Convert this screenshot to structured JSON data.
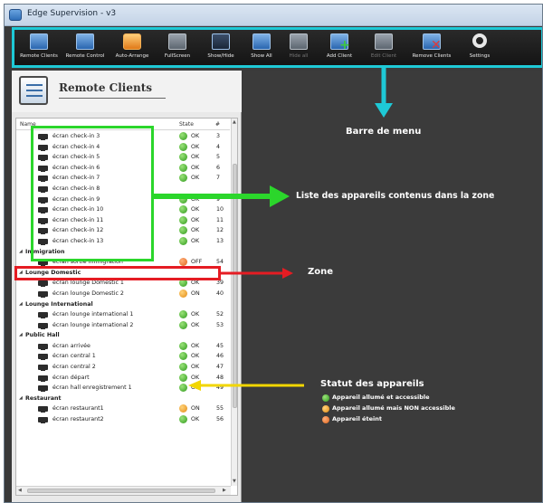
{
  "window": {
    "title": "Edge Supervision - v3"
  },
  "toolbar": {
    "buttons": [
      {
        "label": "Remote Clients",
        "icon": "remote-clients-icon",
        "enabled": true
      },
      {
        "label": "Remote Control",
        "icon": "remote-control-icon",
        "enabled": true
      },
      {
        "label": "Auto-Arrange",
        "icon": "auto-arrange-icon",
        "enabled": true
      },
      {
        "label": "FullScreen",
        "icon": "fullscreen-icon",
        "enabled": true
      },
      {
        "label": "Show/Hide",
        "icon": "show-hide-icon",
        "enabled": true
      },
      {
        "label": "Show All",
        "icon": "show-all-icon",
        "enabled": true
      },
      {
        "label": "Hide all",
        "icon": "hide-all-icon",
        "enabled": false
      },
      {
        "label": "Add Client",
        "icon": "add-client-icon",
        "enabled": true
      },
      {
        "label": "Edit Client",
        "icon": "edit-client-icon",
        "enabled": false
      },
      {
        "label": "Remove Clients",
        "icon": "remove-clients-icon",
        "enabled": true
      },
      {
        "label": "Settings",
        "icon": "settings-icon",
        "enabled": true
      }
    ]
  },
  "panel": {
    "title": "Remote Clients",
    "columns": {
      "name": "Name",
      "state": "State",
      "id": "#"
    },
    "rows": [
      {
        "type": "device",
        "name": "écran check-in 3",
        "status": "ok",
        "state": "OK",
        "id": "3"
      },
      {
        "type": "device",
        "name": "écran check-in 4",
        "status": "ok",
        "state": "OK",
        "id": "4"
      },
      {
        "type": "device",
        "name": "écran check-in 5",
        "status": "ok",
        "state": "OK",
        "id": "5"
      },
      {
        "type": "device",
        "name": "écran check-in 6",
        "status": "ok",
        "state": "OK",
        "id": "6"
      },
      {
        "type": "device",
        "name": "écran check-in 7",
        "status": "ok",
        "state": "OK",
        "id": "7"
      },
      {
        "type": "device",
        "name": "écran check-in 8",
        "status": "",
        "state": "",
        "id": ""
      },
      {
        "type": "device",
        "name": "écran check-in 9",
        "status": "ok",
        "state": "OK",
        "id": "9"
      },
      {
        "type": "device",
        "name": "écran check-in 10",
        "status": "ok",
        "state": "OK",
        "id": "10"
      },
      {
        "type": "device",
        "name": "écran check-in 11",
        "status": "ok",
        "state": "OK",
        "id": "11"
      },
      {
        "type": "device",
        "name": "écran check-in 12",
        "status": "ok",
        "state": "OK",
        "id": "12"
      },
      {
        "type": "device",
        "name": "écran check-in 13",
        "status": "ok",
        "state": "OK",
        "id": "13"
      },
      {
        "type": "zone",
        "name": "Immigration"
      },
      {
        "type": "device",
        "name": "écran sortie immigration",
        "status": "off",
        "state": "OFF",
        "id": "54"
      },
      {
        "type": "zone",
        "name": "Lounge Domestic"
      },
      {
        "type": "device",
        "name": "écran lounge Domestic 1",
        "status": "ok",
        "state": "OK",
        "id": "39"
      },
      {
        "type": "device",
        "name": "écran lounge Domestic 2",
        "status": "on",
        "state": "ON",
        "id": "40"
      },
      {
        "type": "zone",
        "name": "Lounge International"
      },
      {
        "type": "device",
        "name": "écran lounge international 1",
        "status": "ok",
        "state": "OK",
        "id": "52"
      },
      {
        "type": "device",
        "name": "écran lounge international 2",
        "status": "ok",
        "state": "OK",
        "id": "53"
      },
      {
        "type": "zone",
        "name": "Public Hall"
      },
      {
        "type": "device",
        "name": "écran arrivée",
        "status": "ok",
        "state": "OK",
        "id": "45"
      },
      {
        "type": "device",
        "name": "écran central 1",
        "status": "ok",
        "state": "OK",
        "id": "46"
      },
      {
        "type": "device",
        "name": "écran central 2",
        "status": "ok",
        "state": "OK",
        "id": "47"
      },
      {
        "type": "device",
        "name": "écran départ",
        "status": "ok",
        "state": "OK",
        "id": "48"
      },
      {
        "type": "device",
        "name": "écran hall enregistrement 1",
        "status": "ok",
        "state": "OK",
        "id": "49"
      },
      {
        "type": "zone",
        "name": "Restaurant"
      },
      {
        "type": "device",
        "name": "écran restaurant1",
        "status": "on",
        "state": "ON",
        "id": "55"
      },
      {
        "type": "device",
        "name": "écran restaurant2",
        "status": "ok",
        "state": "OK",
        "id": "56"
      }
    ]
  },
  "annotations": {
    "menu_bar": "Barre de menu",
    "device_list": "Liste des appareils contenus dans la zone",
    "zone": "Zone",
    "status_title": "Statut des appareils",
    "legend": [
      {
        "status": "ok",
        "text": "Appareil allumé et accessible"
      },
      {
        "status": "on",
        "text": "Appareil allumé mais NON accessible"
      },
      {
        "status": "off",
        "text": "Appareil éteint"
      }
    ]
  },
  "colors": {
    "toolbar_highlight": "#1ec9d6",
    "list_highlight": "#2bd62b",
    "zone_highlight": "#e51c23",
    "status_highlight": "#f2d600",
    "status_ok": "#2f9a1c",
    "status_on": "#e38a12",
    "status_off": "#e0641c"
  }
}
